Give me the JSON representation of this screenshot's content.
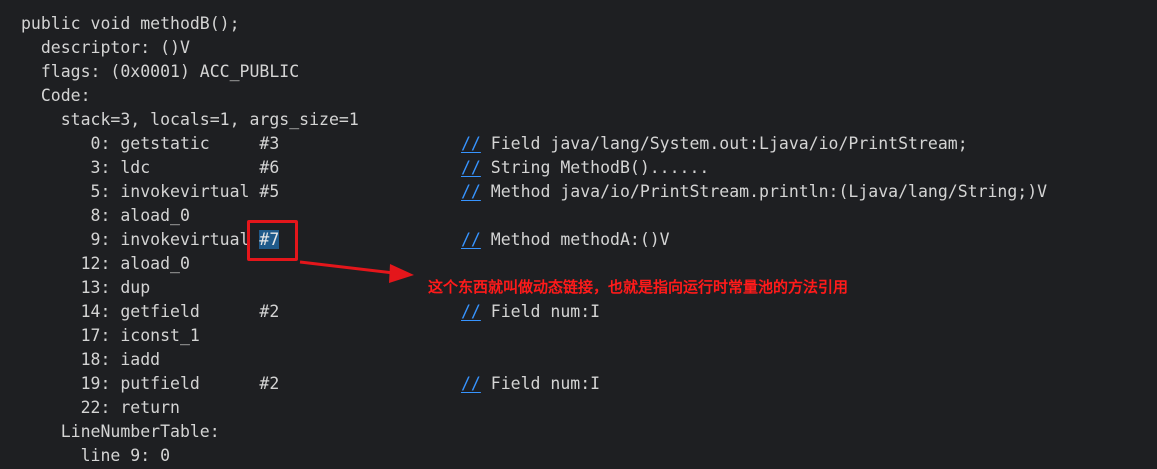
{
  "lines": [
    "public void methodB();",
    "  descriptor: ()V",
    "  flags: (0x0001) ACC_PUBLIC",
    "  Code:",
    "    stack=3, locals=1, args_size=1",
    "       0: getstatic     #3",
    "       3: ldc           #6",
    "       5: invokevirtual #5",
    "       8: aload_0",
    "       9: invokevirtual ",
    "      12: aload_0",
    "      13: dup",
    "      14: getfield      #2",
    "      17: iconst_1",
    "      18: iadd",
    "      19: putfield      #2",
    "      22: return",
    "    LineNumberTable:",
    "      line 9: 0"
  ],
  "highlighted_ref": "#7",
  "comment_marker": "//",
  "comments": {
    "line5": " Field java/lang/System.out:Ljava/io/PrintStream;",
    "line6": " String MethodB()......",
    "line7": " Method java/io/PrintStream.println:(Ljava/lang/String;)V",
    "line9": " Method methodA:()V",
    "line12": " Field num:I",
    "line15": " Field num:I"
  },
  "annotation": {
    "text": "这个东西就叫做动态链接，也就是指向运行时常量池的方法引用",
    "color": "#e4161b"
  },
  "colors": {
    "background": "#1e1f22",
    "text": "#d4d4d4",
    "comment_marker": "#3794ff",
    "selection": "#1f5a8a"
  }
}
